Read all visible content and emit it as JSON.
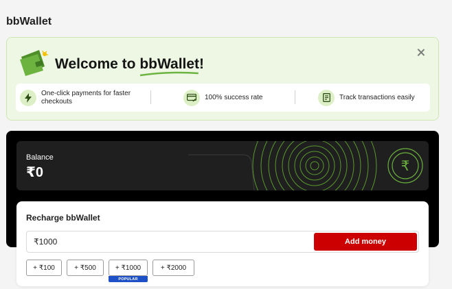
{
  "page": {
    "title": "bbWallet"
  },
  "welcome": {
    "title_prefix": "Welcome to ",
    "title_brand": "bbWallet",
    "title_suffix": "!",
    "features": [
      {
        "icon": "lightning-icon",
        "text_line1": "One-click payments for faster",
        "text_line2": "checkouts"
      },
      {
        "icon": "card-check-icon",
        "text": "100% success rate"
      },
      {
        "icon": "receipt-icon",
        "text": "Track transactions easily"
      }
    ]
  },
  "balance": {
    "label": "Balance",
    "value": "₹0",
    "symbol": "₹"
  },
  "recharge": {
    "title": "Recharge bbWallet",
    "amount_value": "₹1000",
    "add_money_label": "Add money",
    "chips": [
      "+ ₹100",
      "+ ₹500",
      "+ ₹1000",
      "+ ₹2000"
    ],
    "popular_label": "POPULAR"
  },
  "colors": {
    "accent_red": "#cc0000",
    "accent_green": "#6cb33f",
    "popular_blue": "#1e50c8",
    "banner_bg": "#eef7e3"
  }
}
